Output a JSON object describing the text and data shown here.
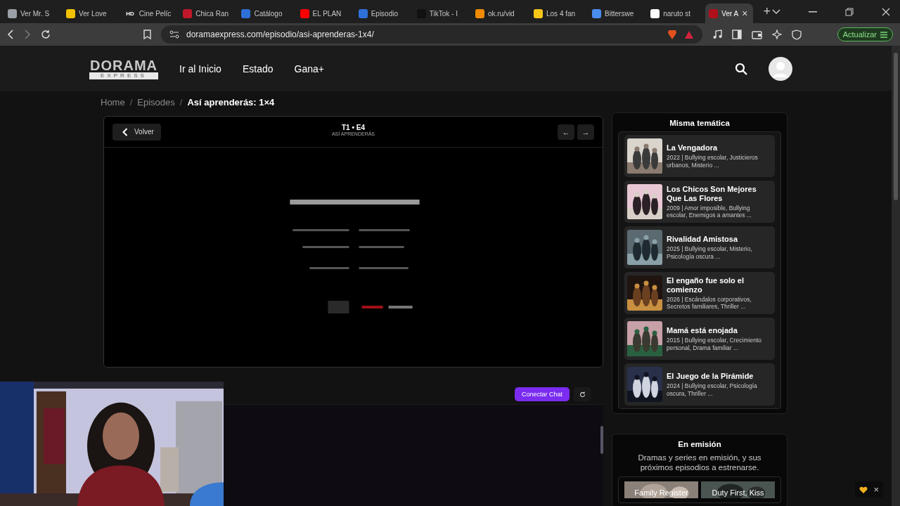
{
  "browser": {
    "tabs": [
      {
        "title": "Ver Mr. S",
        "selected": false,
        "color": "#9aa0a6"
      },
      {
        "title": "Ver Love",
        "selected": false,
        "color": "#f2c200"
      },
      {
        "title": "Cine Pelíc",
        "selected": false,
        "color": "#202020",
        "badge": "HD"
      },
      {
        "title": "Chica Ran",
        "selected": false,
        "color": "#c0182a"
      },
      {
        "title": "Catálogo",
        "selected": false,
        "color": "#2f6fd8"
      },
      {
        "title": "EL PLAN",
        "selected": false,
        "color": "#ff0000"
      },
      {
        "title": "Episodio",
        "selected": false,
        "color": "#2f6fd8"
      },
      {
        "title": "TikTok - I",
        "selected": false,
        "color": "#111111"
      },
      {
        "title": "ok.ru/vid",
        "selected": false,
        "color": "#f28b00"
      },
      {
        "title": "Los 4 fan",
        "selected": false,
        "color": "#f5c518"
      },
      {
        "title": "Bitterswe",
        "selected": false,
        "color": "#4a8df0"
      },
      {
        "title": "naruto st",
        "selected": false,
        "color": "#ffffff"
      },
      {
        "title": "Ver A",
        "selected": true,
        "color": "#b0101c"
      }
    ],
    "close_tab": "×",
    "new_tab": "+",
    "url": "doramaexpress.com/episodio/asi-aprenderas-1x4/",
    "update_button": "Actualizar"
  },
  "site": {
    "logo_top": "DORAMA",
    "logo_bottom": "EXPRESS",
    "nav": [
      "Ir al Inicio",
      "Estado",
      "Gana+"
    ]
  },
  "breadcrumb": {
    "separator": "/",
    "items": [
      "Home",
      "Episodes",
      "Así aprenderás: 1×4"
    ]
  },
  "player": {
    "back_button": "Volver",
    "episode": "T1 • E4",
    "episode_title": "ASÍ APRENDERÁS",
    "prev": "←",
    "next": "→"
  },
  "chat": {
    "connect_button": "Conectar Chat"
  },
  "related": {
    "title": "Misma temática",
    "items": [
      {
        "title": "La Vengadora",
        "meta": "2022 | Bullying escolar, Justicieros urbanos, Misterio ..."
      },
      {
        "title": "Los Chicos Son Mejores Que Las Flores",
        "meta": "2009 | Amor imposible, Bullying escolar, Enemigos a amantes ..."
      },
      {
        "title": "Rivalidad Amistosa",
        "meta": "2025 | Bullying escolar, Misterio, Psicología oscura ..."
      },
      {
        "title": "El engaño fue solo el comienzo",
        "meta": "2026 | Escándalos corporativos, Secretos familiares, Thriller ..."
      },
      {
        "title": "Mamá está enojada",
        "meta": "2015 | Bullying escolar, Crecimiento personal, Drama familiar ..."
      },
      {
        "title": "El Juego de la Pirámide",
        "meta": "2024 | Bullying escolar, Psicología oscura, Thriller ..."
      }
    ]
  },
  "airing": {
    "title": "En emisión",
    "description": "Dramas y series en emisión, y sus próximos episodios a estrenarse.",
    "cards": [
      {
        "title": "Family Register"
      },
      {
        "title": "Duty First, Kiss"
      }
    ]
  },
  "widget": {
    "close": "×"
  }
}
